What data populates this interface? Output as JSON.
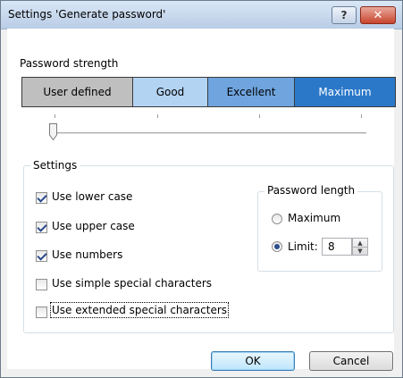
{
  "window": {
    "title": "Settings 'Generate password'",
    "help_label": "?",
    "close_label": "✕"
  },
  "strength": {
    "label": "Password strength",
    "levels": [
      "User defined",
      "Good",
      "Excellent",
      "Maximum"
    ],
    "slider_position": "User defined"
  },
  "settings": {
    "group_label": "Settings",
    "options": [
      {
        "label": "Use lower case",
        "checked": true
      },
      {
        "label": "Use upper case",
        "checked": true
      },
      {
        "label": "Use numbers",
        "checked": true
      },
      {
        "label": "Use simple special characters",
        "checked": false
      },
      {
        "label": "Use extended special characters",
        "checked": false
      }
    ]
  },
  "password_length": {
    "group_label": "Password length",
    "maximum_label": "Maximum",
    "limit_label": "Limit:",
    "selected": "Limit",
    "limit_value": "8"
  },
  "buttons": {
    "ok": "OK",
    "cancel": "Cancel"
  }
}
